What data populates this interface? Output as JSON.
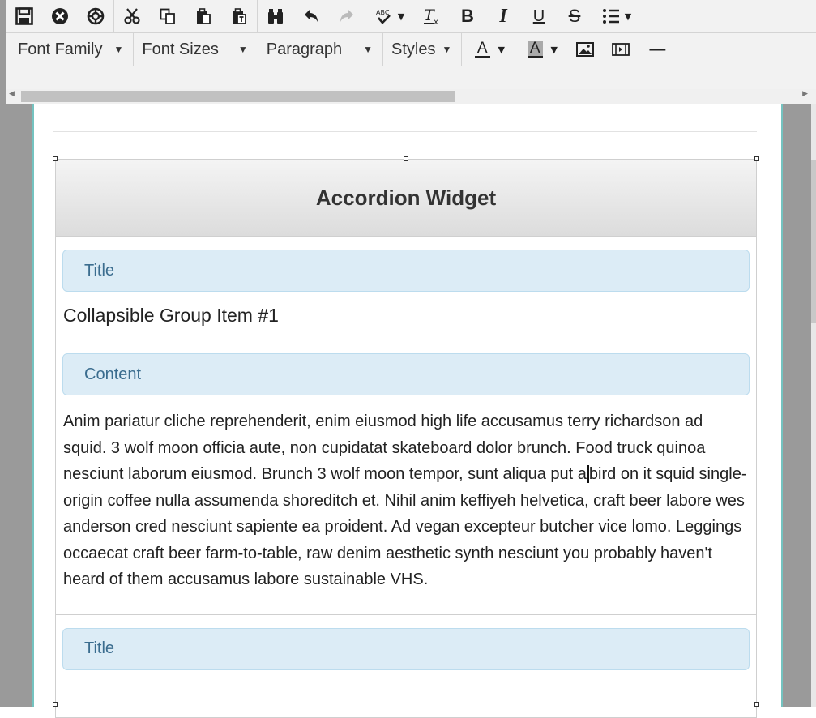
{
  "toolbar": {
    "row1": [
      {
        "icon": "save-icon",
        "glyph": "💾"
      },
      {
        "icon": "cancel-icon",
        "glyph": "✖"
      },
      {
        "icon": "help-icon",
        "glyph": "⊕"
      },
      {
        "icon": "cut-icon",
        "glyph": "✂"
      },
      {
        "icon": "copy-icon",
        "glyph": "⎘"
      },
      {
        "icon": "paste-icon",
        "glyph": "📋"
      },
      {
        "icon": "paste-text-icon",
        "glyph": "📄"
      },
      {
        "icon": "find-icon",
        "glyph": "🔭"
      },
      {
        "icon": "undo-icon",
        "glyph": "↶"
      },
      {
        "icon": "redo-icon",
        "glyph": "↷"
      },
      {
        "icon": "spellcheck-icon",
        "glyph": "✔"
      },
      {
        "icon": "clear-format-icon",
        "glyph": "T"
      },
      {
        "icon": "bold-icon",
        "glyph": "B"
      },
      {
        "icon": "italic-icon",
        "glyph": "I"
      },
      {
        "icon": "underline-icon",
        "glyph": "U"
      },
      {
        "icon": "strikethrough-icon",
        "glyph": "S"
      },
      {
        "icon": "bullet-list-icon",
        "glyph": "☰"
      }
    ],
    "font_family": "Font Family",
    "font_sizes": "Font Sizes",
    "paragraph": "Paragraph",
    "styles": "Styles",
    "text_color_glyph": "A",
    "bg_color_glyph": "A",
    "hr_glyph": "—"
  },
  "editor": {
    "widget_title": "Accordion Widget",
    "items": [
      {
        "title_label": "Title",
        "title_value": "Collapsible Group Item #1",
        "content_label": "Content",
        "content_before_cursor": "Anim pariatur cliche reprehenderit, enim eiusmod high life accusamus terry richardson ad squid. 3 wolf moon officia aute, non cupidatat skateboard dolor brunch. Food truck quinoa nesciunt laborum eiusmod. Brunch 3 wolf moon tempor, sunt aliqua put a",
        "content_after_cursor": "bird on it squid single-origin coffee nulla assumenda shoreditch et. Nihil anim keffiyeh helvetica, craft beer labore wes anderson cred nesciunt sapiente ea proident. Ad vegan excepteur butcher vice lomo. Leggings occaecat craft beer farm-to-table, raw denim aesthetic synth nesciunt you probably haven't heard of them accusamus labore sustainable VHS."
      },
      {
        "title_label": "Title"
      }
    ]
  },
  "colors": {
    "label_bg": "#dcecf6",
    "label_text": "#3b6d8f",
    "page_border": "#74c3c0"
  }
}
